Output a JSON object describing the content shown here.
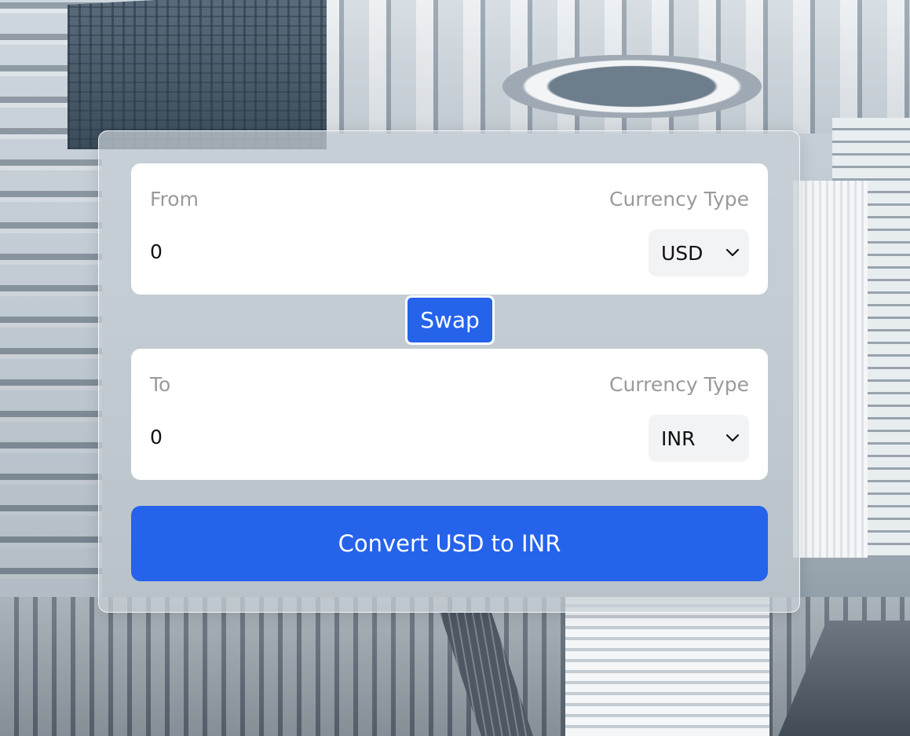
{
  "from": {
    "label": "From",
    "currency_type_label": "Currency Type",
    "amount": "0",
    "currency": "USD"
  },
  "swap_label": "Swap",
  "to": {
    "label": "To",
    "currency_type_label": "Currency Type",
    "amount": "0",
    "currency": "INR"
  },
  "convert_label": "Convert USD to INR",
  "icons": {
    "from_select": "chevron-down-icon",
    "to_select": "chevron-down-icon"
  },
  "colors": {
    "accent": "#2563eb",
    "card": "#ffffff",
    "label": "#9a9a9a",
    "select_bg": "#f2f3f5"
  }
}
